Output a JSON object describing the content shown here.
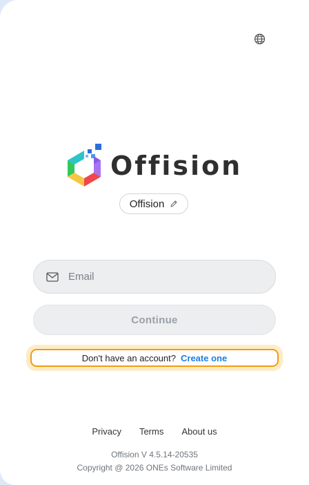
{
  "header": {
    "language_icon": "globe-icon"
  },
  "brand": {
    "name": "Offision",
    "logo_icon": "offision-hexagon-logo",
    "colors": {
      "green": "#34c85a",
      "yellow": "#f7c744",
      "red": "#f0464e",
      "purple": "#a872f0",
      "blue": "#2a6fe0",
      "teal": "#2ec4c9"
    }
  },
  "workspace": {
    "name": "Offision",
    "edit_icon": "pencil-icon"
  },
  "login": {
    "email_icon": "mail-icon",
    "email_placeholder": "Email",
    "email_value": "",
    "continue_label": "Continue"
  },
  "signup": {
    "question": "Don't have an account?",
    "link_label": "Create one",
    "highlight_color": "#f29b10",
    "link_color": "#1e7ee0"
  },
  "footer": {
    "links": [
      "Privacy",
      "Terms",
      "About us"
    ],
    "version": "Offision V 4.5.14-20535",
    "copyright": "Copyright @ 2026 ONEs Software Limited"
  }
}
